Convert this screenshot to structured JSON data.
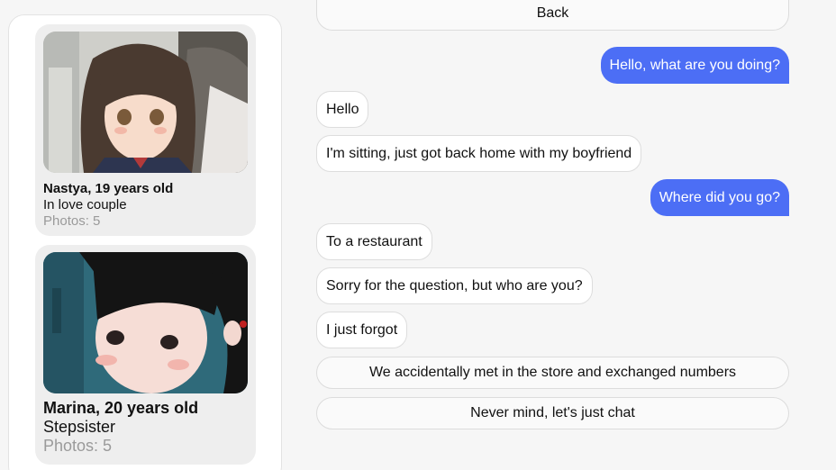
{
  "sidebar": {
    "cards": [
      {
        "name": "Nastya, 19 years old",
        "role": "In love couple",
        "photos": "Photos: 5"
      },
      {
        "name": "Marina, 20 years old",
        "role": "Stepsister",
        "photos": "Photos: 5"
      }
    ]
  },
  "chat": {
    "back_label": "Back",
    "messages": [
      {
        "from": "user",
        "text": "Hello, what are you doing?"
      },
      {
        "from": "bot",
        "text": "Hello"
      },
      {
        "from": "bot",
        "text": "I'm sitting, just got back home with my boyfriend"
      },
      {
        "from": "user",
        "text": "Where did you go?"
      },
      {
        "from": "bot",
        "text": "To a restaurant"
      },
      {
        "from": "bot",
        "text": "Sorry for the question, but who are you?"
      },
      {
        "from": "bot",
        "text": "I just forgot"
      }
    ],
    "options": [
      "We accidentally met in the store and exchanged numbers",
      "Never mind, let's just chat"
    ]
  },
  "colors": {
    "user_bubble": "#4c6ef5",
    "background": "#f6f6f6"
  }
}
